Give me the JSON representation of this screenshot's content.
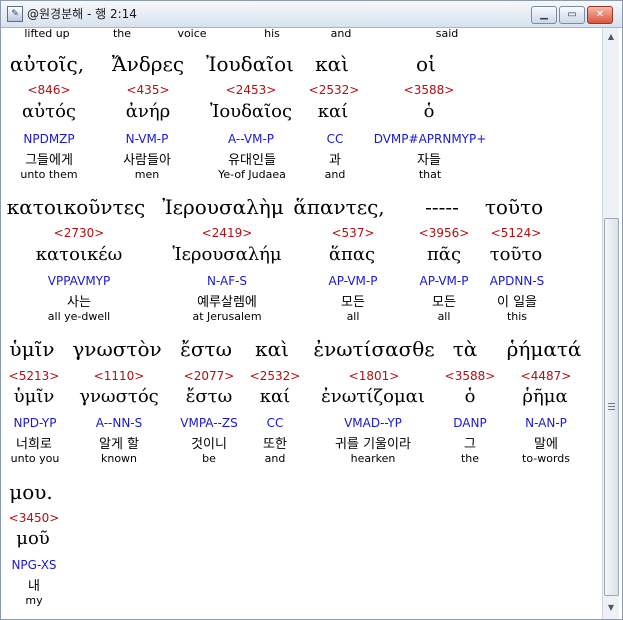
{
  "window": {
    "title": "@원경분해 - 행 2:14",
    "icon": "app-icon"
  },
  "top_partial": [
    "lifted up",
    "the",
    "voice",
    "his",
    "and",
    "said"
  ],
  "row1": {
    "greek": [
      "αὐτοῖς,",
      "Ἄνδρες",
      "Ἰουδαῖοι",
      "καὶ",
      "οἱ"
    ],
    "strongs": [
      "<846>",
      "<435>",
      "<2453>",
      "<2532>",
      "<3588>"
    ],
    "lemmas": [
      "αὐτός",
      "ἀνήρ",
      "Ἰουδαῖος",
      "καί",
      "ὁ"
    ],
    "parsing": [
      "NPDMZP",
      "N-VM-P",
      "A--VM-P",
      "CC",
      "DVMP#APRNMYP+"
    ],
    "korean": [
      "그들에게",
      "사람들아",
      "유대인들",
      "과",
      "자들"
    ],
    "english": [
      "unto them",
      "men",
      "Ye-of Judaea",
      "and",
      "that"
    ]
  },
  "row2": {
    "greek": [
      "κατοικοῦντες",
      "Ἰερουσαλὴμ",
      "ἅπαντες,",
      "-----",
      "τοῦτο"
    ],
    "strongs": [
      "<2730>",
      "<2419>",
      "<537>",
      "<3956>",
      "<5124>"
    ],
    "lemmas": [
      "κατοικέω",
      "Ἱερουσαλήμ",
      "ἅπας",
      "πᾶς",
      "τοῦτο"
    ],
    "parsing": [
      "VPPAVMYP",
      "N-AF-S",
      "AP-VM-P",
      "AP-VM-P",
      "APDNN-S"
    ],
    "korean": [
      "사는",
      "예루살렘에",
      "모든",
      "모든",
      "이 일을"
    ],
    "english": [
      "all ye-dwell",
      "at Jerusalem",
      "all",
      "all",
      "this"
    ]
  },
  "row3": {
    "greek": [
      "ὑμῖν",
      "γνωστὸν",
      "ἔστω",
      "καὶ",
      "ἐνωτίσασθε",
      "τὰ",
      "ῥήματά"
    ],
    "strongs": [
      "<5213>",
      "<1110>",
      "<2077>",
      "<2532>",
      "<1801>",
      "<3588>",
      "<4487>"
    ],
    "lemmas": [
      "ὑμῖν",
      "γνωστός",
      "ἔστω",
      "καί",
      "ἐνωτίζομαι",
      "ὁ",
      "ῥῆμα"
    ],
    "parsing": [
      "NPD-YP",
      "A--NN-S",
      "VMPA--ZS",
      "CC",
      "VMAD--YP",
      "DANP",
      "N-AN-P"
    ],
    "korean": [
      "너희로",
      "알게 할",
      "것이니",
      "또한",
      "귀를 기울이라",
      "그",
      "말에"
    ],
    "english": [
      "unto you",
      "known",
      "be",
      "and",
      "hearken",
      "the",
      "to-words"
    ]
  },
  "row4": {
    "greek": [
      "μου."
    ],
    "strongs": [
      "<3450>"
    ],
    "lemmas": [
      "μοῦ"
    ],
    "parsing": [
      "NPG-XS"
    ],
    "korean": [
      "내"
    ],
    "english": [
      "my"
    ]
  }
}
